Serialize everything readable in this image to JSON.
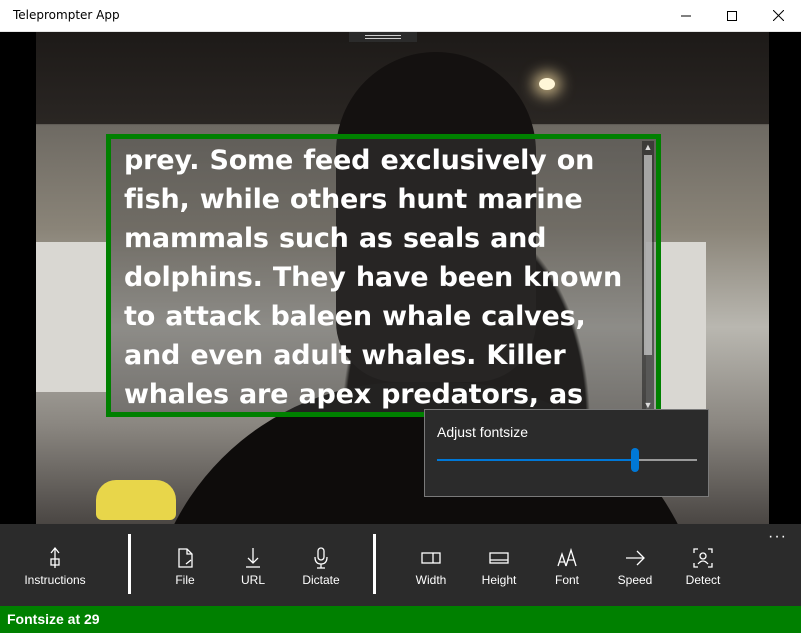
{
  "window": {
    "title": "Teleprompter App",
    "buttons": [
      "minimize",
      "maximize",
      "close"
    ]
  },
  "prompter": {
    "text": "prey. Some feed exclusively on fish, while others hunt marine mammals such as seals and dolphins. They have been known to attack baleen whale calves, and even adult whales. Killer whales are apex predators, as there is no animal that preys on them. Kil",
    "border_color": "#008000"
  },
  "fontsize_flyout": {
    "label": "Adjust fontsize",
    "slider_fraction": 0.76,
    "accent_color": "#0078d7"
  },
  "command_bar": {
    "more": "···",
    "groups": [
      [
        {
          "id": "instructions",
          "label": "Instructions",
          "icon": "instructions-icon"
        }
      ],
      [
        {
          "id": "file",
          "label": "File",
          "icon": "file-icon"
        },
        {
          "id": "url",
          "label": "URL",
          "icon": "download-icon"
        },
        {
          "id": "dictate",
          "label": "Dictate",
          "icon": "microphone-icon"
        }
      ],
      [
        {
          "id": "width",
          "label": "Width",
          "icon": "width-icon"
        },
        {
          "id": "height",
          "label": "Height",
          "icon": "height-icon"
        },
        {
          "id": "font",
          "label": "Font",
          "icon": "font-icon"
        },
        {
          "id": "speed",
          "label": "Speed",
          "icon": "arrow-right-icon"
        },
        {
          "id": "detect",
          "label": "Detect",
          "icon": "face-detect-icon"
        }
      ]
    ]
  },
  "status": {
    "text": "Fontsize at 29",
    "color": "#008000"
  }
}
